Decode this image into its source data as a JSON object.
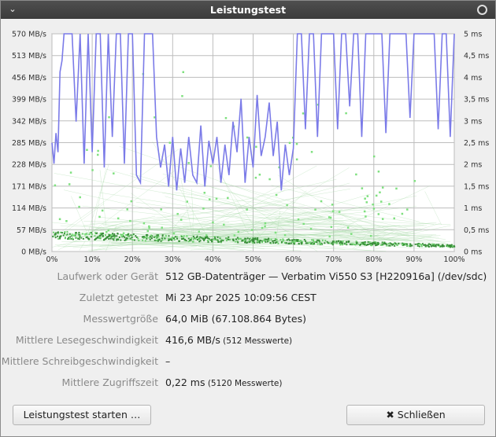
{
  "window": {
    "title": "Leistungstest",
    "menu_icon": "chevron-down-icon",
    "close_icon": "circle-close-icon"
  },
  "chart_data": {
    "type": "line",
    "x": [
      0,
      10,
      20,
      30,
      40,
      50,
      60,
      70,
      80,
      90,
      100
    ],
    "x_tick_labels": [
      "0%",
      "10%",
      "20%",
      "30%",
      "40%",
      "50%",
      "60%",
      "70%",
      "80%",
      "90%",
      "100%"
    ],
    "y_left_ticks": [
      "0 MB/s",
      "57 MB/s",
      "114 MB/s",
      "171 MB/s",
      "228 MB/s",
      "285 MB/s",
      "342 MB/s",
      "399 MB/s",
      "456 MB/s",
      "513 MB/s",
      "570 MB/s"
    ],
    "y_right_ticks": [
      "0 ms",
      "0,5 ms",
      "1 ms",
      "1,5 ms",
      "2 ms",
      "2,5 ms",
      "3 ms",
      "3,5 ms",
      "4 ms",
      "4,5 ms",
      "5 ms"
    ],
    "ylim_left": [
      0,
      570
    ],
    "ylim_right": [
      0,
      5
    ],
    "grid": true,
    "series": [
      {
        "color": "#7b7be8",
        "x": [
          0,
          0.5,
          1,
          1.5,
          2,
          2.5,
          3,
          3.5,
          4,
          5,
          6,
          7,
          8,
          9,
          10,
          11,
          12,
          13,
          14,
          15,
          16,
          17,
          18,
          19,
          20,
          21,
          22,
          23,
          24,
          25,
          26,
          27,
          28,
          29,
          30,
          31,
          32,
          33,
          34,
          35,
          36,
          37,
          38,
          39,
          40,
          41,
          42,
          43,
          44,
          45,
          46,
          47,
          48,
          49,
          50,
          51,
          52,
          53,
          54,
          55,
          56,
          57,
          58,
          59,
          60,
          61,
          62,
          63,
          64,
          65,
          66,
          67,
          68,
          69,
          70,
          71,
          72,
          73,
          74,
          75,
          76,
          77,
          78,
          79,
          80,
          81,
          82,
          83,
          84,
          85,
          86,
          87,
          88,
          89,
          90,
          91,
          92,
          93,
          94,
          95,
          96,
          97,
          98,
          99,
          100
        ],
        "y": [
          285,
          230,
          310,
          260,
          470,
          500,
          570,
          570,
          570,
          570,
          340,
          570,
          230,
          570,
          260,
          570,
          570,
          220,
          570,
          300,
          570,
          570,
          230,
          570,
          570,
          200,
          180,
          570,
          570,
          570,
          300,
          220,
          280,
          170,
          300,
          160,
          270,
          180,
          300,
          200,
          180,
          330,
          170,
          290,
          230,
          300,
          180,
          280,
          200,
          340,
          260,
          400,
          180,
          300,
          220,
          410,
          250,
          300,
          390,
          250,
          340,
          160,
          280,
          200,
          270,
          570,
          570,
          320,
          570,
          570,
          300,
          570,
          570,
          570,
          570,
          320,
          570,
          570,
          380,
          570,
          570,
          300,
          570,
          570,
          570,
          570,
          570,
          310,
          570,
          570,
          570,
          570,
          570,
          350,
          570,
          570,
          570,
          570,
          570,
          570,
          320,
          570,
          570,
          300,
          570
        ]
      },
      {
        "color": "#3a9a3a",
        "role": "access-time samples"
      }
    ]
  },
  "info": [
    {
      "label": "Laufwerk oder Gerät",
      "value": "512 GB-Datenträger — Verbatim Vi550 S3 [H220916a] (/dev/sdc)",
      "sub": ""
    },
    {
      "label": "Zuletzt getestet",
      "value": "Mi 23 Apr 2025 10:09:56 CEST",
      "sub": ""
    },
    {
      "label": "Messwertgröße",
      "value": "64,0 MiB (67.108.864 Bytes)",
      "sub": ""
    },
    {
      "label": "Mittlere Lesegeschwindigkeit",
      "value": "416,6 MB/s",
      "sub": "(512 Messwerte)"
    },
    {
      "label": "Mittlere Schreibgeschwindigkeit",
      "value": "–",
      "sub": ""
    },
    {
      "label": "Mittlere Zugriffszeit",
      "value": "0,22 ms",
      "sub": "(5120 Messwerte)"
    }
  ],
  "buttons": {
    "start": "Leistungstest starten …",
    "close": "Schließen",
    "close_icon": "x-icon"
  }
}
